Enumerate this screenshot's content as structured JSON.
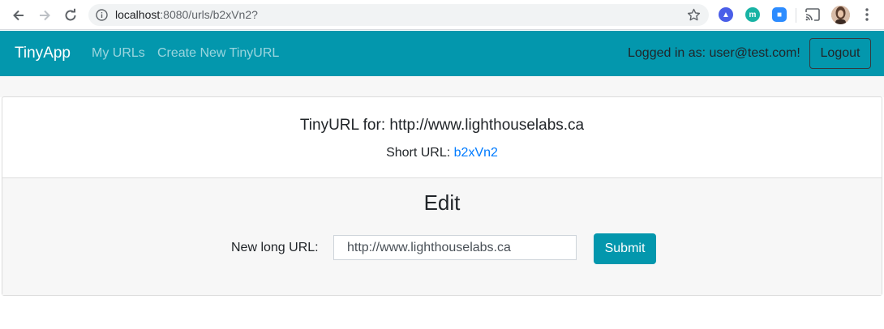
{
  "browser": {
    "url_host": "localhost",
    "url_path": ":8080/urls/b2xVn2?",
    "extensions": [
      {
        "name": "arrow-extension",
        "color": "#4a5ee8",
        "glyph": "▲"
      },
      {
        "name": "m-extension",
        "color": "#18b3a4",
        "glyph": "m"
      },
      {
        "name": "zoom-extension",
        "color": "#2d8cff",
        "glyph": "■"
      }
    ]
  },
  "navbar": {
    "brand": "TinyApp",
    "links": [
      "My URLs",
      "Create New TinyURL"
    ],
    "logged_in_text": "Logged in as: user@test.com!",
    "logout_label": "Logout",
    "color": "#0397ad"
  },
  "card": {
    "title": "TinyURL for: http://www.lighthouselabs.ca",
    "short_url_label": "Short URL: ",
    "short_url_link": "b2xVn2",
    "edit_heading": "Edit",
    "form_label": "New long URL:",
    "input_value": "http://www.lighthouselabs.ca",
    "submit_label": "Submit"
  }
}
